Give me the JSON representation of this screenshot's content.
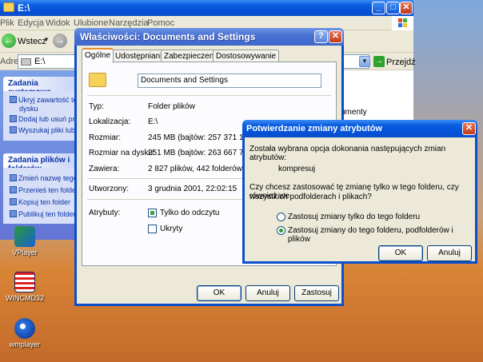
{
  "explorer": {
    "title": "E:\\",
    "menu": [
      "Plik",
      "Edycja",
      "Widok",
      "Ulubione",
      "Narzędzia",
      "Pomoc"
    ],
    "back_label": "Wstecz",
    "address_label": "Adres",
    "address_value": "E:\\",
    "go_label": "Przejdź",
    "tasks_system": {
      "header": "Zadania systemowe",
      "items": [
        "Ukryj zawartość tego",
        "dysku",
        "Dodaj lub usuń programy",
        "Wyszukaj pliki lub foldery"
      ]
    },
    "tasks_files": {
      "header": "Zadania plików i folderów",
      "items": [
        "Zmień nazwę tego folderu",
        "Przenieś ten folder",
        "Kopiuj ten folder",
        "Publikuj ten folder"
      ]
    },
    "right_fragment": "umenty"
  },
  "desktop_icons": [
    {
      "label": "VPlayer",
      "icon": "vplayer-icon"
    },
    {
      "label": "WINCMD32",
      "icon": "wincmd-icon"
    },
    {
      "label": "wmplayer",
      "icon": "wmplayer-icon"
    }
  ],
  "properties": {
    "title": "Właściwości: Documents and Settings",
    "help_glyph": "?",
    "close_glyph": "✕",
    "tabs": [
      "Ogólne",
      "Udostępnianie",
      "Zabezpieczenia",
      "Dostosowywanie"
    ],
    "name_value": "Documents and Settings",
    "rows": [
      {
        "label": "Typ:",
        "value": "Folder plików"
      },
      {
        "label": "Lokalizacja:",
        "value": "E:\\"
      },
      {
        "label": "Rozmiar:",
        "value": "245 MB (bajtów: 257 371 154)"
      },
      {
        "label": "Rozmiar na dysku:",
        "value": "251 MB (bajtów: 263 667 712)"
      },
      {
        "label": "Zawiera:",
        "value": "2 827 plików, 442 folderów"
      }
    ],
    "created_label": "Utworzony:",
    "created_value": "3 grudnia 2001, 22:02:15",
    "attributes_label": "Atrybuty:",
    "readonly_label": "Tylko do odczytu",
    "hidden_label": "Ukryty",
    "buttons": {
      "ok": "OK",
      "cancel": "Anuluj",
      "apply": "Zastosuj"
    }
  },
  "confirm": {
    "title": "Potwierdzanie zmiany atrybutów",
    "close_glyph": "✕",
    "intro": "Została wybrana opcja dokonania następujących zmian atrybutów:",
    "change": "kompresuj",
    "question_line1": "Czy chcesz zastosować tę zmianę tylko w tego folderu, czy również we",
    "question_line2": "wszystkich podfolderach i plikach?",
    "option_folder_only": "Zastosuj zmiany tylko do tego folderu",
    "option_all": "Zastosuj zmiany do tego folderu, podfolderów i plików",
    "selected_option": "all",
    "buttons": {
      "ok": "OK",
      "cancel": "Anuluj"
    }
  }
}
